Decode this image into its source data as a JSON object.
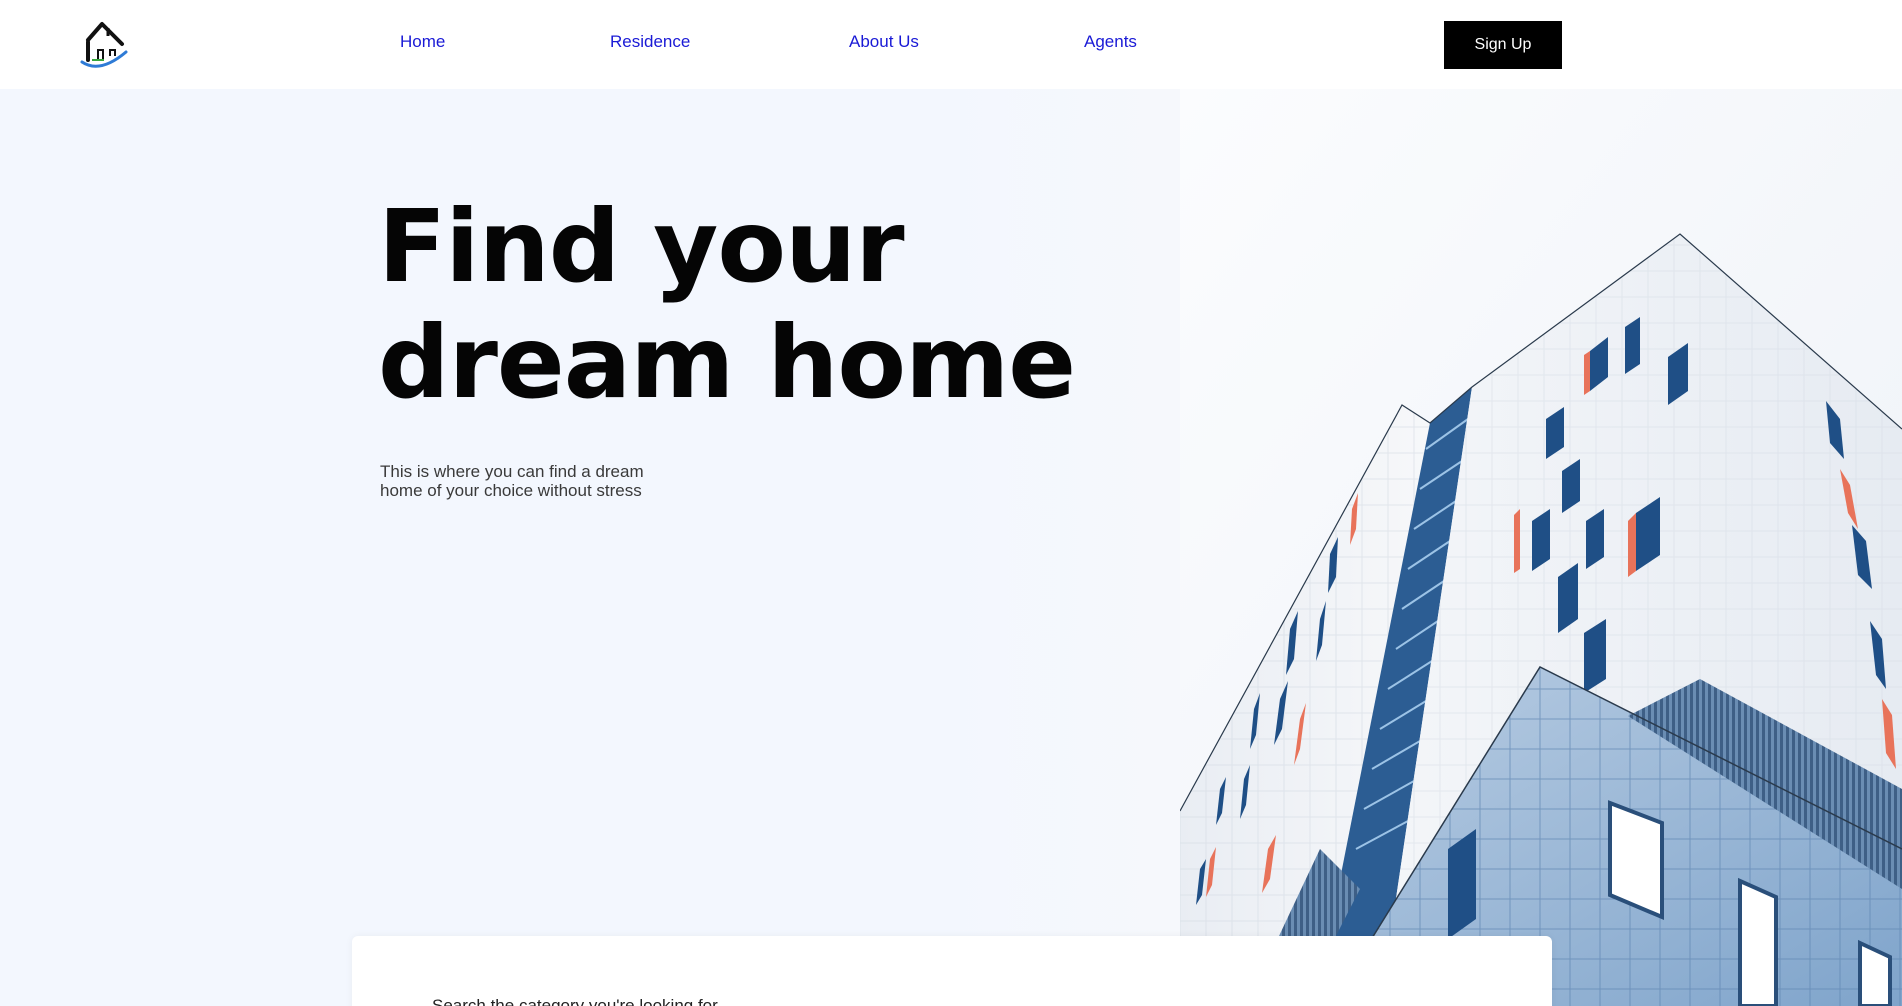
{
  "nav": {
    "logo_icon": "house-logo-icon",
    "links": [
      {
        "label": "Home"
      },
      {
        "label": "Residence"
      },
      {
        "label": "About Us"
      },
      {
        "label": "Agents"
      }
    ],
    "signup_label": "Sign Up",
    "link_color": "#1a1ad6"
  },
  "hero": {
    "title_line1": "Find your",
    "title_line2": "dream home",
    "subtitle_line1": "This is where you can find a dream",
    "subtitle_line2": "home of your choice without stress",
    "background_color": "#f3f7fe",
    "image": "building-photo"
  },
  "search": {
    "hint": "Search the category you're looking for"
  }
}
